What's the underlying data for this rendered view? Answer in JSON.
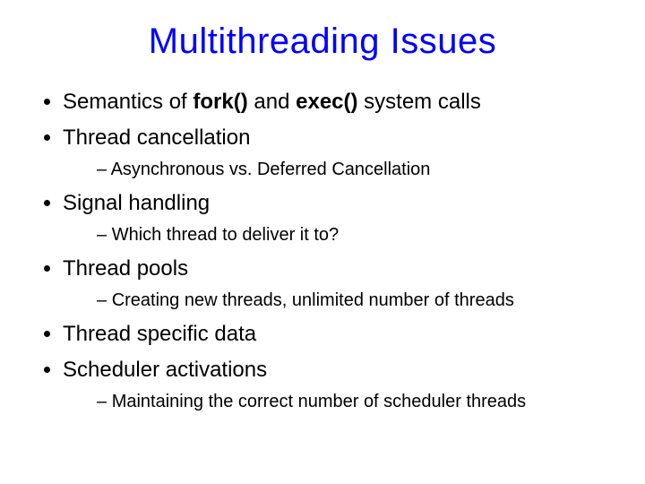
{
  "colors": {
    "title": "#0000ff",
    "body": "#000000"
  },
  "title": "Multithreading Issues",
  "bullets": {
    "b1_pre": "Semantics of ",
    "b1_bold1": "fork()",
    "b1_mid": " and ",
    "b1_bold2": "exec()",
    "b1_post": " system calls",
    "b2": "Thread cancellation",
    "b2_sub1": "Asynchronous vs. Deferred Cancellation",
    "b3": "Signal handling",
    "b3_sub1": "Which thread to deliver it to?",
    "b4": "Thread pools",
    "b4_sub1": "Creating new threads, unlimited number of threads",
    "b5": "Thread specific data",
    "b6": "Scheduler activations",
    "b6_sub1": "Maintaining the correct number of scheduler threads"
  }
}
